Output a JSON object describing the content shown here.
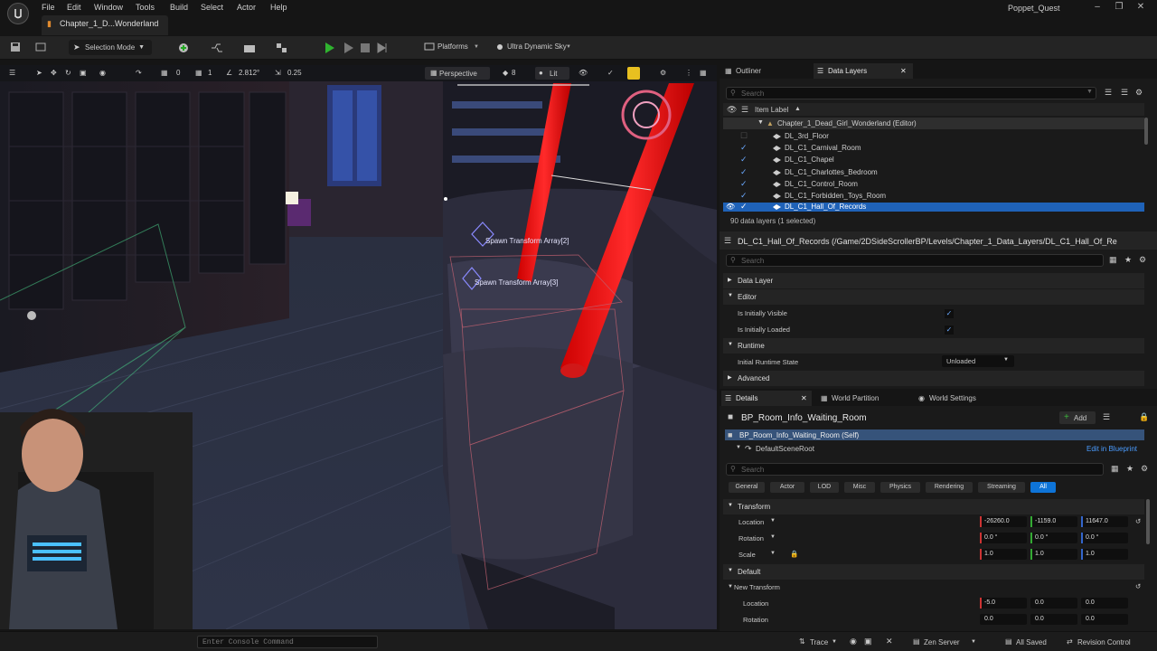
{
  "title_bar": {
    "menu": [
      "File",
      "Edit",
      "Window",
      "Tools",
      "Build",
      "Select",
      "Actor",
      "Help"
    ],
    "project_name": "Poppet_Quest",
    "level_tab": "Chapter_1_D...Wonderland"
  },
  "toolbar": {
    "selection_mode": "Selection Mode",
    "platforms": "Platforms",
    "ultra_dynamic_sky": "Ultra Dynamic Sky"
  },
  "viewport": {
    "rotate_snap": "0",
    "grid_snap": "1",
    "camera_speed_scale": "2.812°",
    "scale_snap": "0.25",
    "view_mode": "Perspective",
    "fov": "8",
    "lighting": "Lit",
    "labels": [
      "Spawn Transform Array[2]",
      "Spawn Transform Array[3]"
    ]
  },
  "outliner": {
    "tabs": [
      "Outliner",
      "Data Layers"
    ],
    "search_placeholder": "Search",
    "column_header": "Item Label",
    "parent": "Chapter_1_Dead_Girl_Wonderland (Editor)",
    "layers": [
      "DL_3rd_Floor",
      "DL_C1_Carnival_Room",
      "DL_C1_Chapel",
      "DL_C1_Charlottes_Bedroom",
      "DL_C1_Control_Room",
      "DL_C1_Forbidden_Toys_Room",
      "DL_C1_Hall_Of_Records"
    ],
    "footer": "90 data layers (1 selected)"
  },
  "data_layer_details": {
    "path": "DL_C1_Hall_Of_Records (/Game/2DSideScrollerBP/Levels/Chapter_1_Data_Layers/DL_C1_Hall_Of_Re",
    "search_placeholder": "Search",
    "categories": [
      "Data Layer",
      "Editor",
      "Runtime",
      "Advanced"
    ],
    "is_initially_visible": "Is Initially Visible",
    "is_initially_loaded": "Is Initially Loaded",
    "initial_runtime_state": "Initial Runtime State",
    "runtime_state_value": "Unloaded"
  },
  "details": {
    "tabs": [
      "Details",
      "World Partition",
      "World Settings"
    ],
    "actor_name": "BP_Room_Info_Waiting_Room",
    "add_label": "Add",
    "self_row": "BP_Room_Info_Waiting_Room (Self)",
    "scene_root": "DefaultSceneRoot",
    "edit_blueprint": "Edit in Blueprint",
    "search_placeholder": "Search",
    "filters": [
      "General",
      "Actor",
      "LOD",
      "Misc",
      "Physics",
      "Rendering",
      "Streaming",
      "All"
    ],
    "transform_header": "Transform",
    "location_label": "Location",
    "rotation_label": "Rotation",
    "scale_label": "Scale",
    "location": [
      "-26260.0",
      "-1159.0",
      "11647.0"
    ],
    "rotation": [
      "0.0 °",
      "0.0 °",
      "0.0 °"
    ],
    "scale": [
      "1.0",
      "1.0",
      "1.0"
    ],
    "default_header": "Default",
    "new_transform_header": "New Transform",
    "nt_location": [
      "-5.0",
      "0.0",
      "0.0"
    ],
    "nt_rotation": [
      "0.0",
      "0.0",
      "0.0"
    ]
  },
  "status_bar": {
    "console_placeholder": "Enter Console Command",
    "trace": "Trace",
    "zen_server": "Zen Server",
    "all_saved": "All Saved",
    "revision_control": "Revision Control"
  },
  "colors": {
    "accent": "#0e74d8",
    "selected_row": "#1f62b8",
    "red_beam": "#e8141c"
  }
}
